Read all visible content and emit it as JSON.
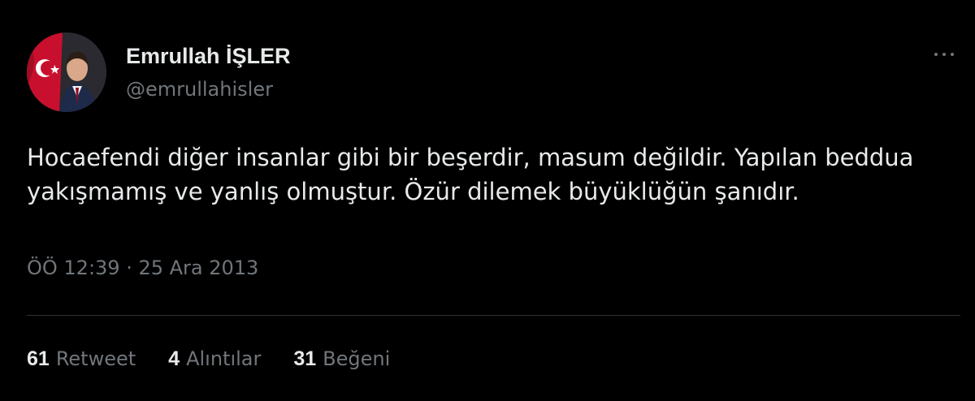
{
  "author": {
    "name": "Emrullah İŞLER",
    "handle": "@emrullahisler"
  },
  "tweet": {
    "lines": [
      "Hocaefendi diğer insanlar gibi bir beşerdir, masum değildir. Yapılan beddua",
      "yakışmamış ve yanlış olmuştur. Özür dilemek büyüklüğün şanıdır."
    ],
    "timestamp": "ÖÖ 12:39 · 25 Ara 2013"
  },
  "stats": [
    {
      "count": "61",
      "label": "Retweet"
    },
    {
      "count": "4",
      "label": "Alıntılar"
    },
    {
      "count": "31",
      "label": "Beğeni"
    }
  ],
  "icons": {
    "more": "more-dots-icon"
  },
  "colors": {
    "background": "#000000",
    "primary_text": "#e7e9ea",
    "secondary_text": "#71767b",
    "divider": "#2f3336"
  }
}
